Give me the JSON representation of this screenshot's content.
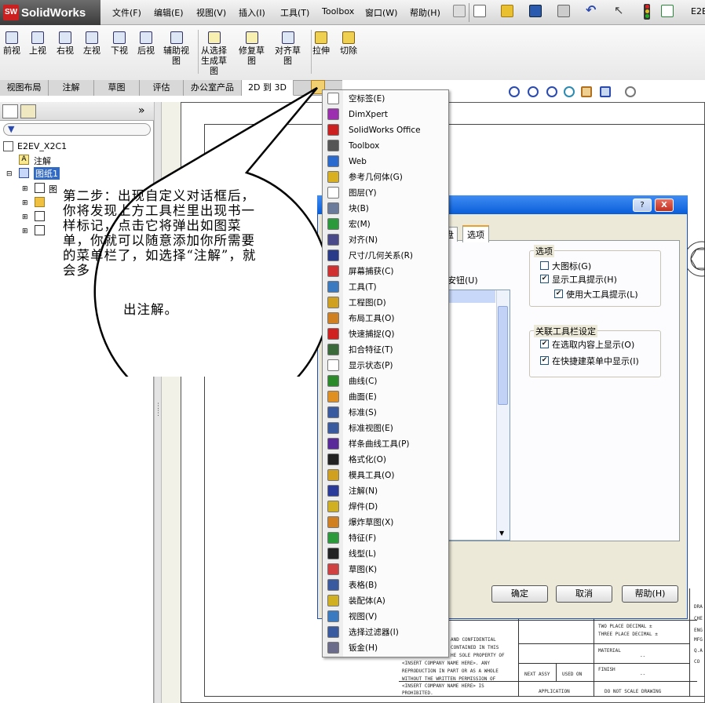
{
  "app": {
    "title": "SolidWorks",
    "brand_color": "#cc2020",
    "doc_short": "E2E"
  },
  "menubar": [
    "文件(F)",
    "编辑(E)",
    "视图(V)",
    "插入(I)",
    "工具(T)",
    "Toolbox",
    "窗口(W)",
    "帮助(H)"
  ],
  "command_buttons": [
    {
      "label": "前视"
    },
    {
      "label": "上视"
    },
    {
      "label": "右视"
    },
    {
      "label": "左视"
    },
    {
      "label": "下视"
    },
    {
      "label": "后视"
    },
    {
      "label": "辅助视\n图"
    },
    {
      "label": "从选择\n生成草\n图"
    },
    {
      "label": "修复草\n图"
    },
    {
      "label": "对齐草\n图"
    },
    {
      "label": "拉伸"
    },
    {
      "label": "切除"
    }
  ],
  "tabs": [
    "视图布局",
    "注解",
    "草图",
    "评估",
    "办公室产品",
    "2D 到 3D"
  ],
  "active_tab": "2D 到 3D",
  "tree": {
    "root": "E2EV_X2C1",
    "annotation": "注解",
    "sheet": "图纸1",
    "child1": "图"
  },
  "callout_text": "第二步：出现自定义对话框后，你将发现上方工具栏里出现书一样标记，点击它将弹出如图菜单，你就可以随意添加你所需要的菜单栏了，如选择“注解”，就会多",
  "callout_last": "出注解。",
  "popup_menu": [
    {
      "label": "空标签(E)",
      "icon": "blank-icon",
      "color": "#ffffff"
    },
    {
      "label": "DimXpert",
      "icon": "dimxpert-icon",
      "color": "#9b2fb0"
    },
    {
      "label": "SolidWorks Office",
      "icon": "solidworks-icon",
      "color": "#cc2020"
    },
    {
      "label": "Toolbox",
      "icon": "toolbox-icon",
      "color": "#555555"
    },
    {
      "label": "Web",
      "icon": "globe-icon",
      "color": "#2a6acf"
    },
    {
      "label": "参考几何体(G)",
      "icon": "reference-geometry-icon",
      "color": "#d8b020"
    },
    {
      "label": "图层(Y)",
      "icon": "layers-icon",
      "color": "#ffffff"
    },
    {
      "label": "块(B)",
      "icon": "block-icon",
      "color": "#6a7a9a"
    },
    {
      "label": "宏(M)",
      "icon": "macro-icon",
      "color": "#2a9a3a"
    },
    {
      "label": "对齐(N)",
      "icon": "align-icon",
      "color": "#4a4a8a"
    },
    {
      "label": "尺寸/几何关系(R)",
      "icon": "dimension-icon",
      "color": "#2a3a8a"
    },
    {
      "label": "屏幕捕获(C)",
      "icon": "screen-capture-icon",
      "color": "#d03030"
    },
    {
      "label": "工具(T)",
      "icon": "tools-icon",
      "color": "#3a7ac0"
    },
    {
      "label": "工程图(D)",
      "icon": "drawing-icon",
      "color": "#d0a020"
    },
    {
      "label": "布局工具(O)",
      "icon": "layout-icon",
      "color": "#d08020"
    },
    {
      "label": "快速捕捉(Q)",
      "icon": "quick-snap-icon",
      "color": "#d02020"
    },
    {
      "label": "扣合特征(T)",
      "icon": "fastening-icon",
      "color": "#3a6a3a"
    },
    {
      "label": "显示状态(P)",
      "icon": "display-state-icon",
      "color": "#ffffff"
    },
    {
      "label": "曲线(C)",
      "icon": "curve-icon",
      "color": "#2a8a2a"
    },
    {
      "label": "曲面(E)",
      "icon": "surface-icon",
      "color": "#e09020"
    },
    {
      "label": "标准(S)",
      "icon": "standard-icon",
      "color": "#3a5aa0"
    },
    {
      "label": "标准视图(E)",
      "icon": "standard-views-icon",
      "color": "#3a5aa0"
    },
    {
      "label": "样条曲线工具(P)",
      "icon": "spline-icon",
      "color": "#5a2a9a"
    },
    {
      "label": "格式化(O)",
      "icon": "format-icon",
      "color": "#222222"
    },
    {
      "label": "模具工具(O)",
      "icon": "mold-icon",
      "color": "#d0a020"
    },
    {
      "label": "注解(N)",
      "icon": "annotation-icon",
      "color": "#2a3a9a"
    },
    {
      "label": "焊件(D)",
      "icon": "weldment-icon",
      "color": "#d0b020"
    },
    {
      "label": "爆炸草图(X)",
      "icon": "explode-sketch-icon",
      "color": "#d08020"
    },
    {
      "label": "特征(F)",
      "icon": "features-icon",
      "color": "#2a9a3a"
    },
    {
      "label": "线型(L)",
      "icon": "line-format-icon",
      "color": "#222222"
    },
    {
      "label": "草图(K)",
      "icon": "sketch-icon",
      "color": "#d04040"
    },
    {
      "label": "表格(B)",
      "icon": "table-icon",
      "color": "#3a5aa0"
    },
    {
      "label": "装配体(A)",
      "icon": "assembly-icon",
      "color": "#d0b020"
    },
    {
      "label": "视图(V)",
      "icon": "view-icon",
      "color": "#3a7ac0"
    },
    {
      "label": "选择过滤器(I)",
      "icon": "selection-filter-icon",
      "color": "#3a5aa0"
    },
    {
      "label": "钣金(H)",
      "icon": "sheet-metal-icon",
      "color": "#6a6a8a"
    }
  ],
  "dialog": {
    "help_btn": "?",
    "close_btn": "X",
    "tab_partial": "盘",
    "tab_options": "选项",
    "list_label_partial": "安钮(U)",
    "options_group": "选项",
    "large_icons": "大图标(G)",
    "show_tooltips": "显示工具提示(H)",
    "use_large_tooltips": "使用大工具提示(L)",
    "context_group": "关联工具栏设定",
    "show_on_selection": "在选取内容上显示(O)",
    "show_in_shortcut": "在快捷建菜单中显示(I)",
    "ok": "确定",
    "cancel": "取消",
    "help": "帮助(H)"
  },
  "title_block": {
    "conf1": "AND CONFIDENTIAL",
    "conf2": "CONTAINED IN THIS",
    "conf3": "HE SOLE PROPERTY OF",
    "conf4": "<INSERT COMPANY NAME HERE>. ANY",
    "conf5": "REPRODUCTION IN PART OR AS A WHOLE",
    "conf6": "WITHOUT THE WRITTEN PERMISSION OF",
    "conf7": "<INSERT COMPANY NAME HERE> IS",
    "conf8": "PROHIBITED.",
    "next_assy": "NEXT ASSY",
    "used_on": "USED ON",
    "application": "APPLICATION",
    "two_place": "TWO PLACE DECIMAL  ±",
    "three_place": "THREE PLACE DECIMAL  ±",
    "material": "MATERIAL",
    "finish": "FINISH",
    "dash": "--",
    "no_scale": "DO NOT SCALE DRAWING",
    "r1": "DRA",
    "r2": "CHE",
    "r3": "ENG",
    "r4": "MFG",
    "r5": "Q.A",
    "r6": "CO"
  }
}
